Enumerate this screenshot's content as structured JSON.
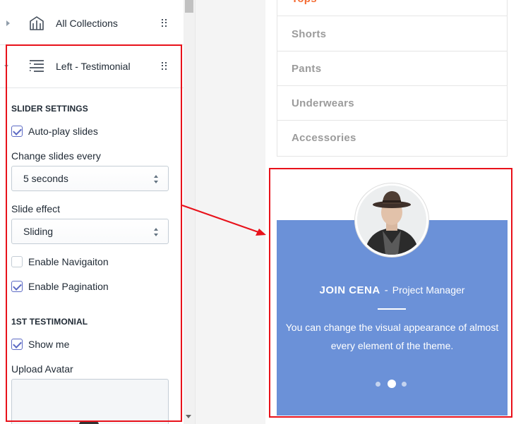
{
  "sidebar": {
    "collapsed_section": {
      "label": "All Collections",
      "icon": "collection-icon"
    },
    "open_section": {
      "label": "Left - Testimonial",
      "icon": "text-lines-icon"
    },
    "slider_heading": "SLIDER SETTINGS",
    "autoplay": {
      "label": "Auto-play slides",
      "checked": true
    },
    "change_every": {
      "label": "Change slides every",
      "value": "5 seconds"
    },
    "slide_effect": {
      "label": "Slide effect",
      "value": "Sliding"
    },
    "enable_navigation": {
      "label": "Enable Navigaiton",
      "checked": false
    },
    "enable_pagination": {
      "label": "Enable Pagination",
      "checked": true
    },
    "testimonial_heading": "1ST TESTIMONIAL",
    "show_me": {
      "label": "Show me",
      "checked": true
    },
    "upload_avatar": {
      "label": "Upload Avatar"
    }
  },
  "preview": {
    "menu": [
      {
        "label": "Tops",
        "active": true
      },
      {
        "label": "Shorts"
      },
      {
        "label": "Pants"
      },
      {
        "label": "Underwears"
      },
      {
        "label": "Accessories"
      }
    ],
    "testimonial": {
      "name": "JOIN CENA",
      "separator": "-",
      "role": "Project Manager",
      "quote": "You can change the visual appearance of almost every element of the theme.",
      "pagination": {
        "count": 3,
        "active_index": 1
      },
      "background": "#6b91d8"
    },
    "colors": {
      "active_menu": "#f46a31",
      "highlight": "#e8111a"
    }
  }
}
